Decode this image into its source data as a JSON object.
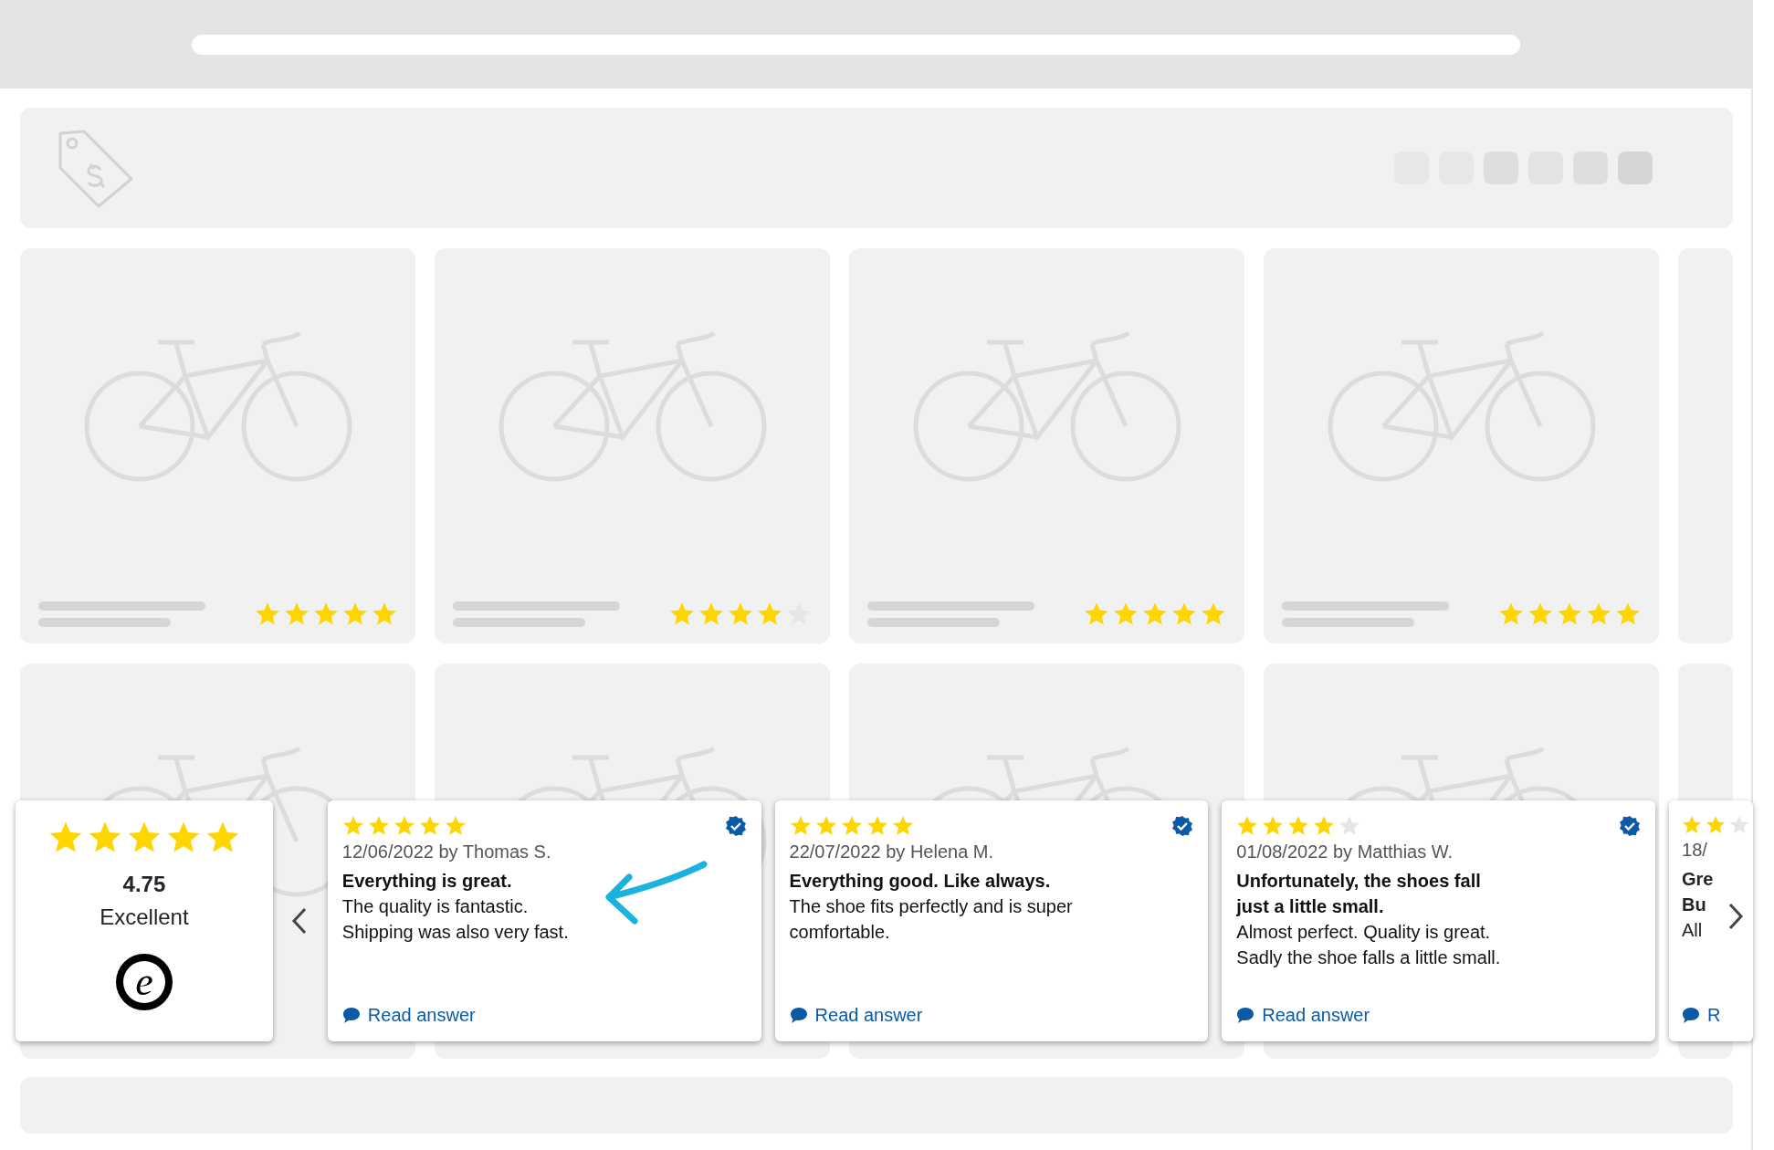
{
  "products": [
    {
      "stars": 5
    },
    {
      "stars": 4
    },
    {
      "stars": 5
    },
    {
      "stars": 5
    }
  ],
  "summary": {
    "stars": 5,
    "score": "4.75",
    "rating": "Excellent",
    "logo": "e"
  },
  "reviews": [
    {
      "stars": 5,
      "verified": true,
      "meta": "12/06/2022 by Thomas S.",
      "title": [
        "Everything is great."
      ],
      "body": [
        "The quality is fantastic.",
        "Shipping was also very fast."
      ],
      "link": "Read answer"
    },
    {
      "stars": 5,
      "verified": true,
      "meta": "22/07/2022 by Helena M.",
      "title": [
        "Everything good. Like always."
      ],
      "body": [
        "The shoe fits perfectly and is super",
        "comfortable."
      ],
      "link": "Read answer"
    },
    {
      "stars": 4,
      "verified": true,
      "meta": "01/08/2022 by Matthias W.",
      "title": [
        "Unfortunately, the shoes fall",
        "just a little small."
      ],
      "body": [
        "Almost perfect. Quality is great.",
        "Sadly the shoe falls a little small."
      ],
      "link": "Read answer"
    }
  ],
  "next_review_peek": {
    "stars": 2,
    "meta": "18/",
    "title": [
      "Gre",
      "Bu"
    ],
    "body": [
      "All"
    ],
    "link": "R"
  }
}
